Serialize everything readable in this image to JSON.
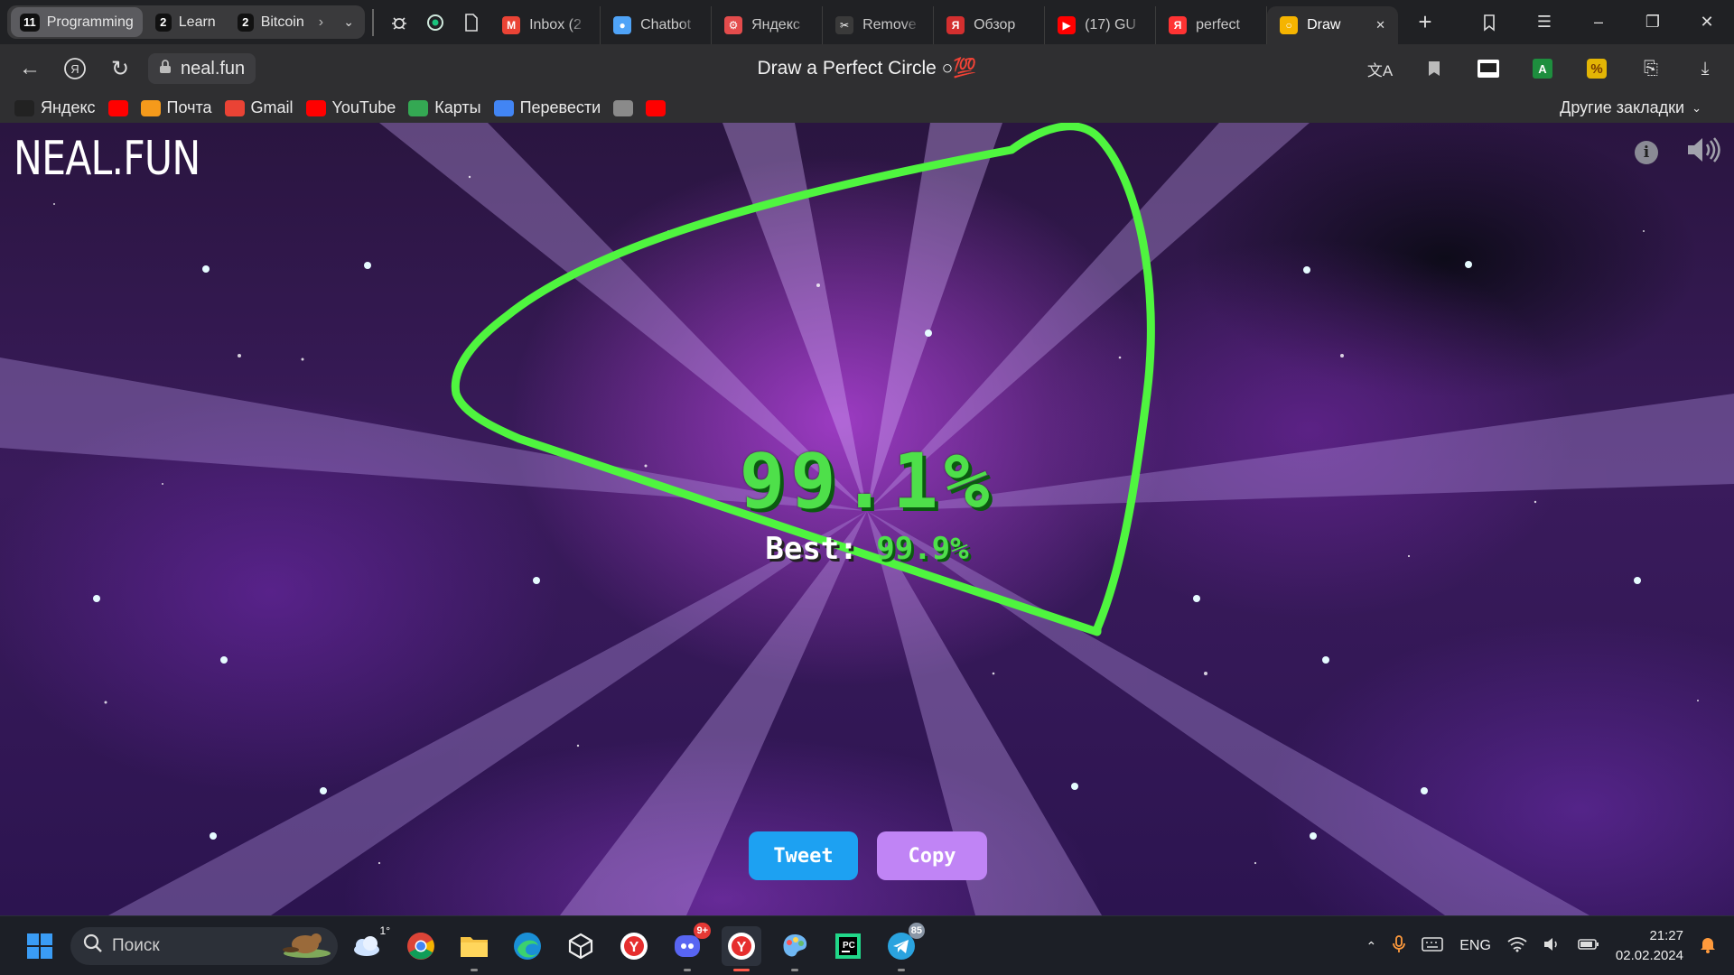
{
  "browser": {
    "tab_groups": [
      {
        "count": "11",
        "name": "Programming",
        "active": true
      },
      {
        "count": "2",
        "name": "Learn"
      },
      {
        "count": "2",
        "name": "Bitcoin"
      }
    ],
    "pinned_icons": [
      "bug-icon",
      "chatgpt-icon",
      "blank-page-icon"
    ],
    "tabs": [
      {
        "title": "Inbox (2",
        "icon": "gmail-icon",
        "icon_color": "#ea4335",
        "glyph": "M"
      },
      {
        "title": "Chatbot",
        "icon": "chat-bubble-icon",
        "icon_color": "#4fa3f7",
        "glyph": "●"
      },
      {
        "title": "Яндекс",
        "icon": "gear-icon",
        "icon_color": "#e34c4c",
        "glyph": "⚙"
      },
      {
        "title": "Remove",
        "icon": "remove-bg-icon",
        "icon_color": "#3a3a3a",
        "glyph": "✂"
      },
      {
        "title": "Обзор",
        "icon": "yandex-icon",
        "icon_color": "#d32f2f",
        "glyph": "Я"
      },
      {
        "title": "(17) GU",
        "icon": "youtube-icon",
        "icon_color": "#ff0000",
        "glyph": "▶"
      },
      {
        "title": "perfect",
        "icon": "yandex-icon",
        "icon_color": "#ff3333",
        "glyph": "Я"
      },
      {
        "title": "Draw",
        "icon": "circle-icon",
        "icon_color": "#f5b400",
        "glyph": "○",
        "active": true
      }
    ],
    "address": "neal.fun",
    "page_title": "Draw a Perfect Circle ○💯",
    "bookmarks": [
      {
        "label": "Яндекс",
        "icon": "yandex-star-icon",
        "color": "#222"
      },
      {
        "label": "",
        "icon": "youtube-icon",
        "color": "#ff0000"
      },
      {
        "label": "Почта",
        "icon": "mail-icon",
        "color": "#f59a1b"
      },
      {
        "label": "Gmail",
        "icon": "gmail-icon",
        "color": "#ea4335"
      },
      {
        "label": "YouTube",
        "icon": "youtube-icon",
        "color": "#ff0000"
      },
      {
        "label": "Карты",
        "icon": "maps-pin-icon",
        "color": "#34a853"
      },
      {
        "label": "Перевести",
        "icon": "translate-icon",
        "color": "#4285f4"
      },
      {
        "label": "",
        "icon": "folder-icon",
        "color": "#8a8a8a"
      },
      {
        "label": "",
        "icon": "youtube-icon",
        "color": "#ff0000"
      }
    ],
    "other_bookmarks": "Другие закладки"
  },
  "site": {
    "logo": "NEAL.FUN",
    "score": "99.1%",
    "best_label": "Best:",
    "best_value": "99.9%",
    "tweet_label": "Tweet",
    "copy_label": "Copy",
    "colors": {
      "stroke": "#4ff53f",
      "score": "#4ee04a",
      "tweet": "#1da1f2",
      "copy": "#c084f5"
    }
  },
  "taskbar": {
    "search_placeholder": "Поиск",
    "weather_temp": "1°",
    "apps": [
      "windows-start-icon",
      "weather-icon",
      "chrome-icon",
      "file-explorer-icon",
      "edge-icon",
      "cube-app-icon",
      "yandex-browser-icon",
      "discord-icon",
      "yandex-browser-active-icon",
      "paint-icon",
      "pycharm-icon",
      "telegram-icon"
    ],
    "discord_badge": "9+",
    "telegram_badge": "85",
    "language": "ENG",
    "time": "21:27",
    "date": "02.02.2024"
  }
}
